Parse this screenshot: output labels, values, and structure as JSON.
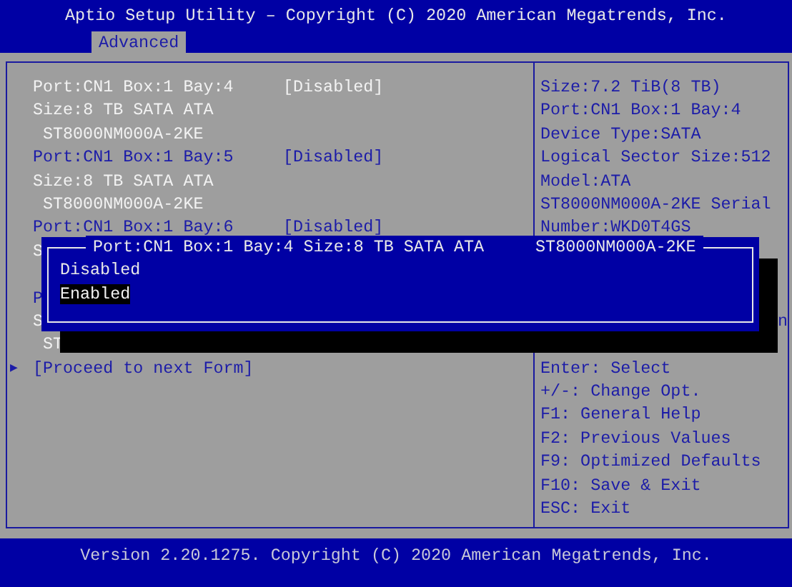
{
  "header": {
    "title": "Aptio Setup Utility – Copyright (C) 2020 American Megatrends, Inc."
  },
  "tabs": [
    {
      "label": "Advanced",
      "selected": true
    }
  ],
  "left": {
    "lines_top": [
      {
        "kind": "port",
        "label": "Port:CN1 Box:1 Bay:4",
        "value": "[Disabled]",
        "selected": true
      },
      {
        "kind": "size",
        "text": "Size:8 TB SATA ATA"
      },
      {
        "kind": "model",
        "text": "ST8000NM000A-2KE"
      },
      {
        "kind": "port",
        "label": "Port:CN1 Box:1 Bay:5",
        "value": "[Disabled]",
        "selected": false
      },
      {
        "kind": "size",
        "text": "Size:8 TB SATA ATA"
      },
      {
        "kind": "model",
        "text": "ST8000NM000A-2KE"
      },
      {
        "kind": "port",
        "label": "Port:CN1 Box:1 Bay:6",
        "value": "[Disabled]",
        "selected": false
      },
      {
        "kind": "size",
        "text": "S"
      }
    ],
    "lines_bottom": [
      {
        "kind": "port",
        "label": "P",
        "selected": false
      },
      {
        "kind": "size",
        "text": "S"
      },
      {
        "kind": "model",
        "text": "ST"
      }
    ],
    "proceed": {
      "arrow": "▶",
      "label": "[Proceed to next Form]"
    }
  },
  "right": {
    "info": [
      "Size:7.2 TiB(8 TB)",
      "Port:CN1 Box:1 Bay:4",
      "Device Type:SATA",
      "Logical Sector Size:512",
      "Model:ATA",
      "ST8000NM000A-2KE Serial",
      "Number:WKD0T4GS"
    ],
    "covered_tail": "n",
    "help": [
      "Enter: Select",
      "+/-: Change Opt.",
      "F1: General Help",
      "F2: Previous Values",
      "F9: Optimized Defaults",
      "F10: Save & Exit",
      "ESC: Exit"
    ]
  },
  "dialog": {
    "title": "Port:CN1 Box:1 Bay:4 Size:8 TB SATA ATA",
    "title_model": "ST8000NM000A-2KE",
    "options": [
      {
        "label": "Disabled",
        "selected": false
      },
      {
        "label": "Enabled",
        "selected": true
      }
    ]
  },
  "footer": {
    "text": "Version 2.20.1275. Copyright (C) 2020 American Megatrends, Inc."
  }
}
